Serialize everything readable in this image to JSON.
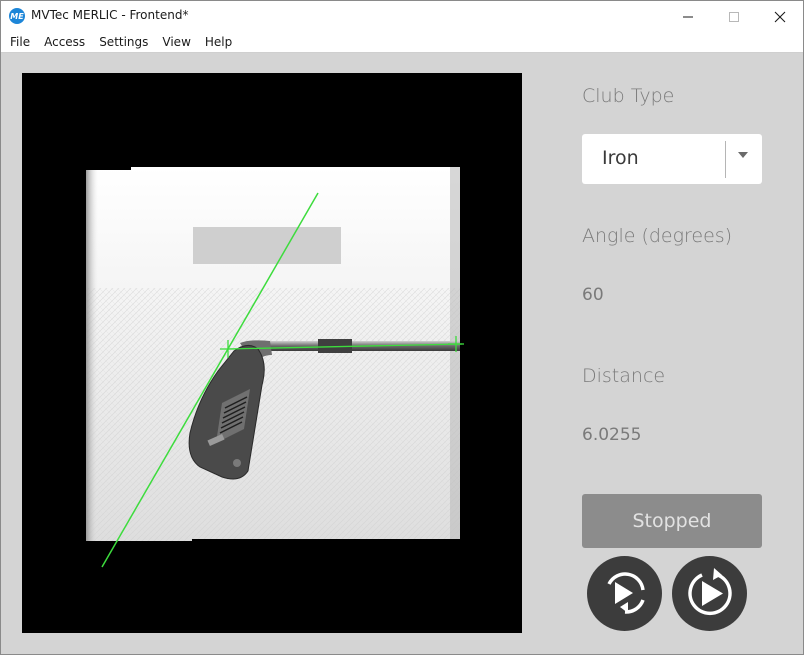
{
  "window": {
    "title": "MVTec MERLIC - Frontend*",
    "app_icon_text": "ME",
    "controls": [
      "minimize-icon",
      "maximize-icon",
      "close-icon"
    ]
  },
  "menu": {
    "items": [
      "File",
      "Access",
      "Settings",
      "View",
      "Help"
    ]
  },
  "panel": {
    "club_type_label": "Club Type",
    "club_type_value": "Iron",
    "angle_label": "Angle (degrees)",
    "angle_value": "60",
    "distance_label": "Distance",
    "distance_value": "6.0255",
    "status_label": "Stopped",
    "buttons": [
      "single-run-icon",
      "continuous-run-icon"
    ]
  },
  "colors": {
    "accent": "#1d86d8",
    "overlay_line": "#3ddc3d",
    "background": "#d4d4d4",
    "status_button": "#8c8c8c",
    "round_button": "#3c3c3c"
  }
}
